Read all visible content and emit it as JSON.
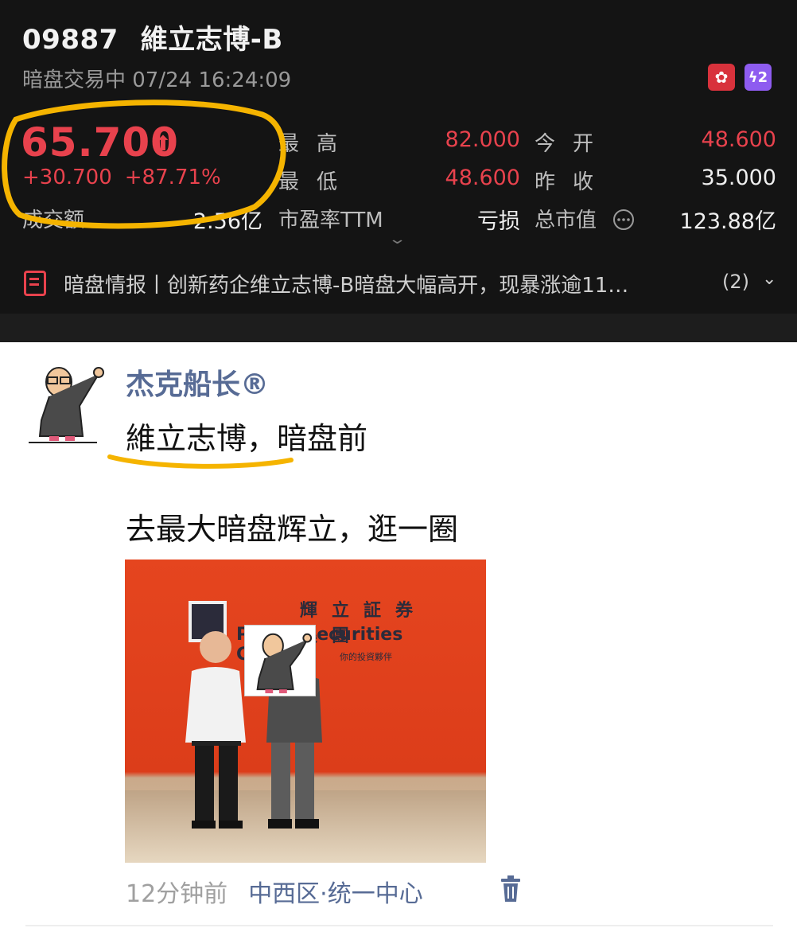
{
  "stock": {
    "code": "09887",
    "name": "維立志博-B",
    "status": "暗盘交易中 07/24 16:24:09",
    "price": "65.700",
    "change": "+30.700",
    "change_pct": "+87.71%",
    "stats": {
      "high_label": "最高",
      "high_value": "82.000",
      "open_label": "今开",
      "open_value": "48.600",
      "low_label": "最低",
      "low_value": "48.600",
      "prev_close_label": "昨收",
      "prev_close_value": "35.000",
      "turnover_label": "成交额",
      "turnover_value": "2.56亿",
      "pe_label": "市盈率TTM",
      "pe_value": "亏损",
      "mktcap_label": "总市值",
      "mktcap_value": "123.88亿"
    },
    "news": {
      "text": "暗盘情报丨创新药企维立志博-B暗盘大幅高开，现暴涨逾11…",
      "count": "(2)"
    },
    "colors": {
      "up": "#e8424d",
      "background": "#141414"
    },
    "icons": [
      "hk-flag-icon",
      "lv2-icon",
      "info-circle-icon",
      "chevron-down-icon",
      "news-doc-icon"
    ]
  },
  "post": {
    "author": "杰克船长®",
    "line1": "維立志博，暗盘前",
    "line2": "去最大暗盘辉立，逛一圈",
    "photo": {
      "sign_cn": "輝立証券集團",
      "sign_en": "Phillip Securities Group",
      "sign_sub": "你的投資夥伴"
    },
    "time": "12分钟前",
    "location": "中西区·统一中心",
    "colors": {
      "link": "#576b95",
      "highlight": "#f5b400"
    },
    "icons": [
      "avatar-cartoon",
      "trash-icon"
    ]
  }
}
